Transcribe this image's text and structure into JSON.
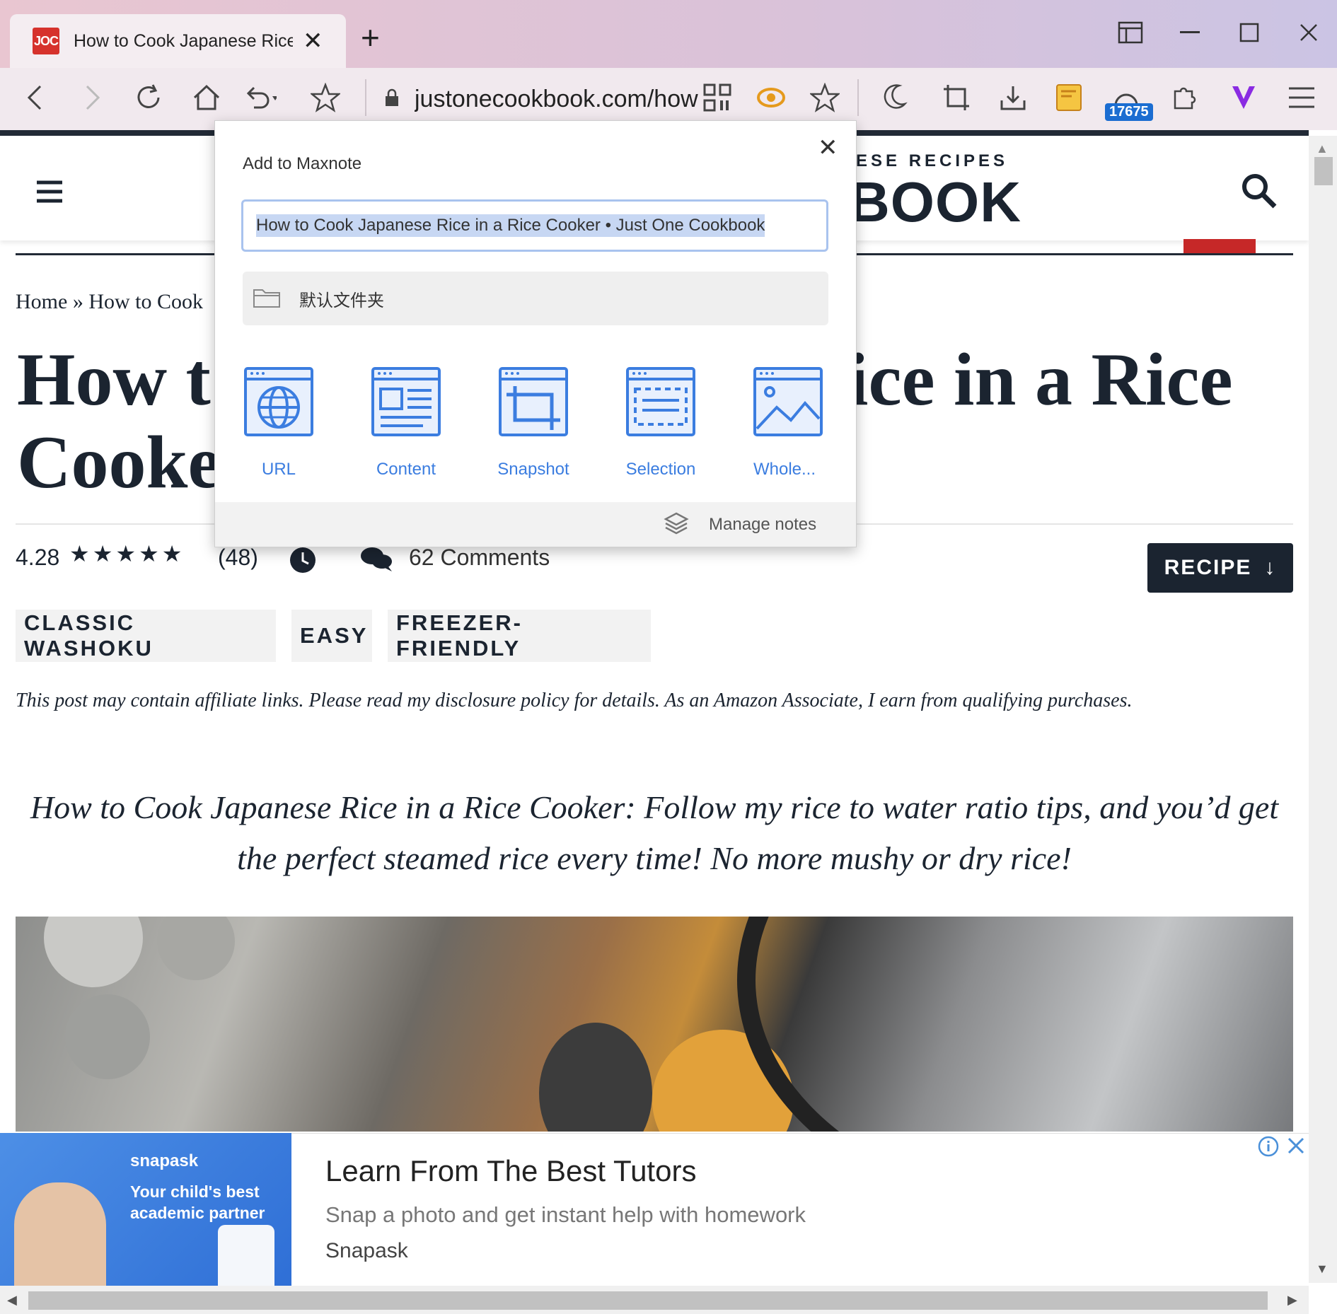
{
  "browser": {
    "tab_title": "How to Cook Japanese Rice i",
    "tab_favicon": "JOC",
    "address": "justonecookbook.com/how",
    "ext_badge": "17675"
  },
  "site": {
    "brand_small": "ESE RECIPES",
    "brand_big": "BOOK",
    "breadcrumb": "Home » How to Cook",
    "title_left_1": "How t",
    "title_left_2": "Cooke",
    "title_right": "ice in a Rice",
    "rating": "4.28",
    "stars": "★★★★★",
    "rating_count": "(48)",
    "comments": "62 Comments",
    "recipe_button": "RECIPE",
    "tags": [
      "CLASSIC WASHOKU",
      "EASY",
      "FREEZER-FRIENDLY"
    ],
    "disclosure": "This post may contain affiliate links. Please read my disclosure policy for details. As an Amazon Associate, I earn from qualifying purchases.",
    "intro": "How to Cook Japanese Rice in a Rice Cooker: Follow my rice to water ratio tips, and you’d get the perfect steamed rice every time! No more mushy or dry rice!"
  },
  "popup": {
    "title": "Add to Maxnote",
    "input_value": "How to Cook Japanese Rice in a Rice Cooker • Just One Cookbook",
    "folder": "默认文件夹",
    "options": [
      "URL",
      "Content",
      "Snapshot",
      "Selection",
      "Whole..."
    ],
    "manage": "Manage notes"
  },
  "ad": {
    "brand_logo": "snapask",
    "img_caption_1": "Your child's best",
    "img_caption_2": "academic partner",
    "title": "Learn From The Best Tutors",
    "subtitle": "Snap a photo and get instant help with homework",
    "advertiser": "Snapask"
  }
}
